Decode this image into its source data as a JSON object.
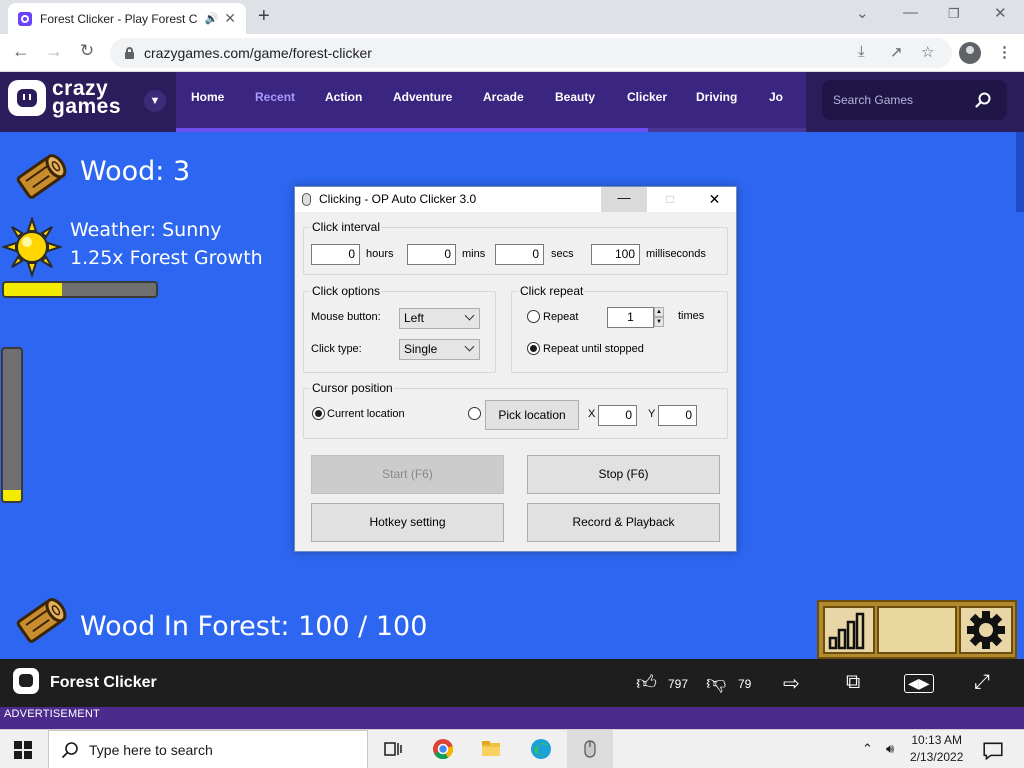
{
  "browser": {
    "tab_title": "Forest Clicker - Play Forest C",
    "url": "crazygames.com/game/forest-clicker"
  },
  "site": {
    "logo_line1": "crazy",
    "logo_line2": "games",
    "nav": [
      "Home",
      "Recent",
      "Action",
      "Adventure",
      "Arcade",
      "Beauty",
      "Clicker",
      "Driving",
      "Jo"
    ],
    "active_nav": "Recent",
    "search_placeholder": "Search Games"
  },
  "game": {
    "wood_label": "Wood: 3",
    "weather_label": "Weather: Sunny",
    "growth_label": "1.25x Forest Growth",
    "forest_label": "Wood In Forest: 100 / 100",
    "growth_bar_fraction": 0.38,
    "vertical_bar_fraction": 0.07,
    "wood_color": "#c98d2e",
    "sun_color": "#ffd600"
  },
  "gamebar": {
    "title": "Forest Clicker",
    "likes": "797",
    "dislikes": "79",
    "advertisement": "ADVERTISEMENT"
  },
  "clicker": {
    "title": "Clicking - OP Auto Clicker 3.0",
    "interval_label": "Click interval",
    "hours_value": "0",
    "hours_label": "hours",
    "mins_value": "0",
    "mins_label": "mins",
    "secs_value": "0",
    "secs_label": "secs",
    "ms_value": "100",
    "ms_label": "milliseconds",
    "options_label": "Click options",
    "mouse_button_label": "Mouse button:",
    "mouse_button_value": "Left",
    "click_type_label": "Click type:",
    "click_type_value": "Single",
    "repeat_group_label": "Click repeat",
    "repeat_label": "Repeat",
    "repeat_value": "1",
    "times_label": "times",
    "repeat_until_label": "Repeat until stopped",
    "cursor_label": "Cursor position",
    "current_location_label": "Current location",
    "pick_location_label": "Pick location",
    "x_label": "X",
    "x_value": "0",
    "y_label": "Y",
    "y_value": "0",
    "start_label": "Start (F6)",
    "stop_label": "Stop (F6)",
    "hotkey_label": "Hotkey setting",
    "record_label": "Record & Playback"
  },
  "taskbar": {
    "search_placeholder": "Type here to search",
    "time": "10:13 AM",
    "date": "2/13/2022"
  }
}
